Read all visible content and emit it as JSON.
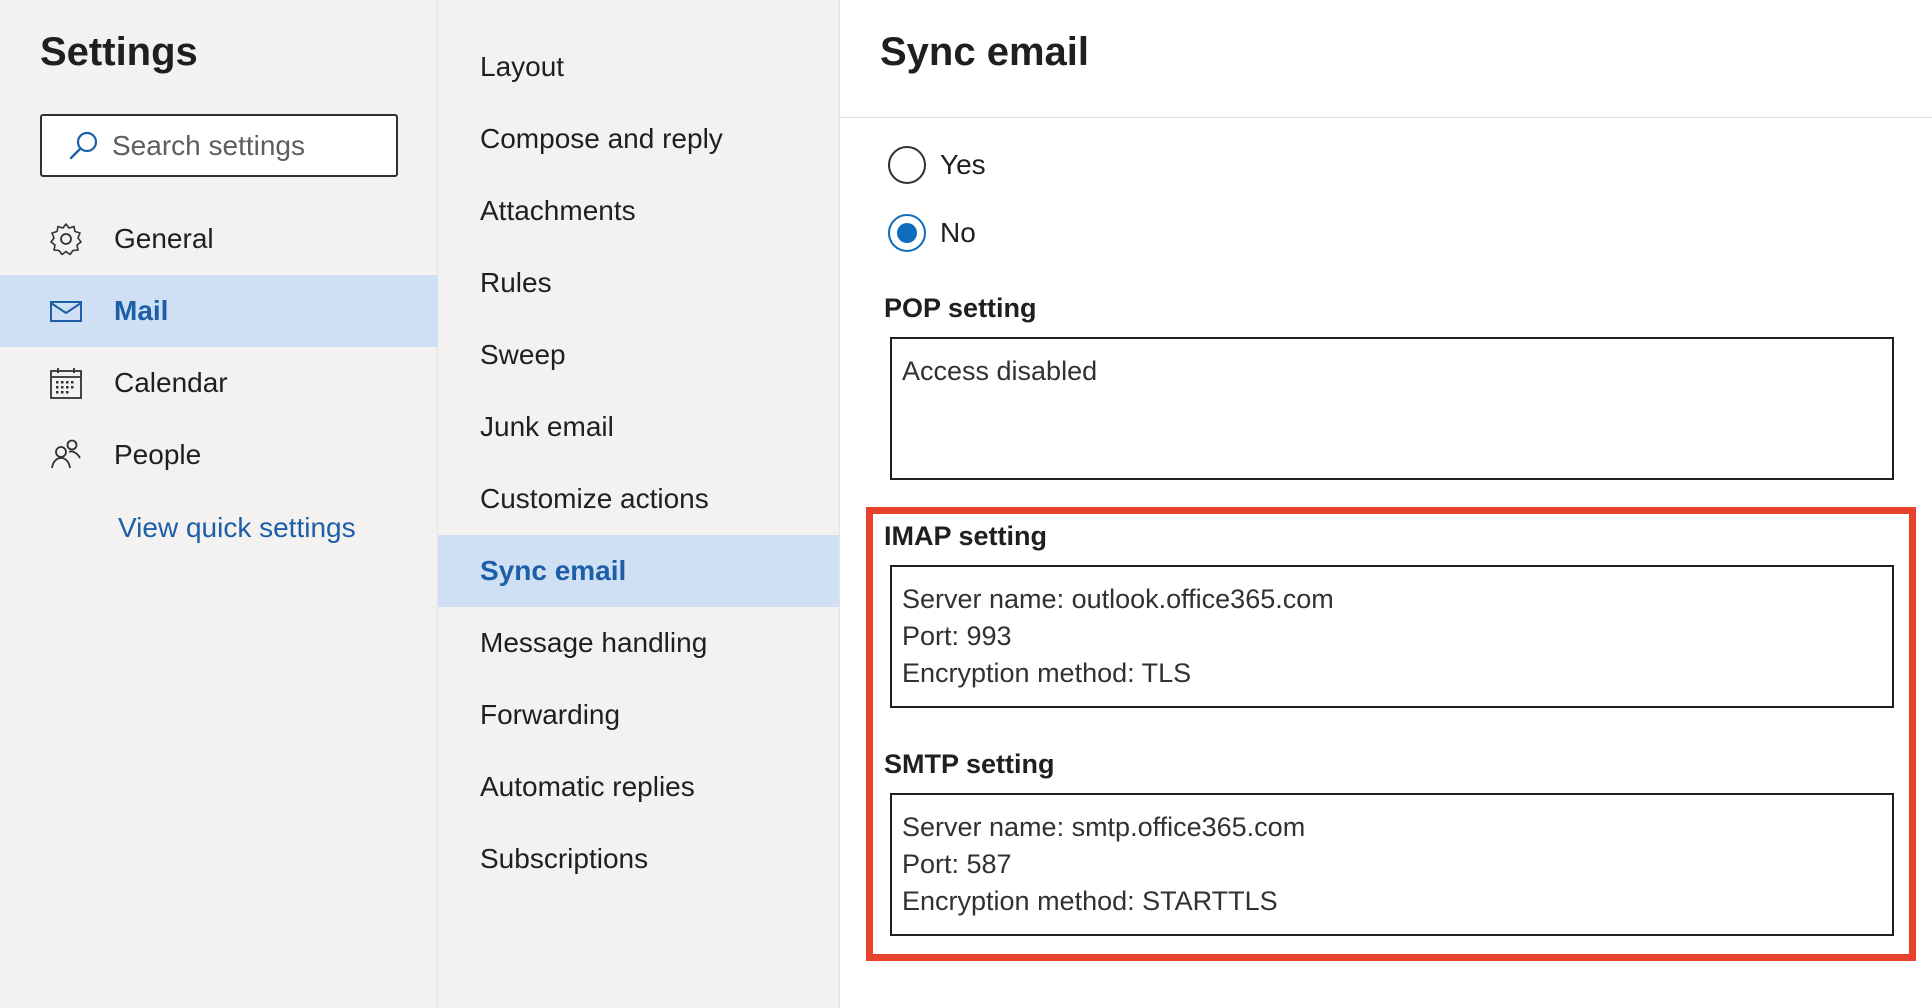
{
  "settings_title": "Settings",
  "search": {
    "placeholder": "Search settings"
  },
  "nav": {
    "items": [
      {
        "label": "General",
        "icon": "gear-icon",
        "selected": false
      },
      {
        "label": "Mail",
        "icon": "mail-icon",
        "selected": true
      },
      {
        "label": "Calendar",
        "icon": "calendar-icon",
        "selected": false
      },
      {
        "label": "People",
        "icon": "people-icon",
        "selected": false
      }
    ],
    "quick_link": "View quick settings"
  },
  "mail_sections": {
    "items": [
      "Layout",
      "Compose and reply",
      "Attachments",
      "Rules",
      "Sweep",
      "Junk email",
      "Customize actions",
      "Sync email",
      "Message handling",
      "Forwarding",
      "Automatic replies",
      "Subscriptions"
    ],
    "selected": "Sync email"
  },
  "content": {
    "title": "Sync email",
    "radio_options": [
      {
        "label": "Yes",
        "checked": false
      },
      {
        "label": "No",
        "checked": true
      }
    ],
    "pop": {
      "label": "POP setting",
      "lines": [
        "Access disabled"
      ]
    },
    "imap": {
      "label": "IMAP setting",
      "lines": [
        "Server name: outlook.office365.com",
        "Port: 993",
        "Encryption method: TLS"
      ]
    },
    "smtp": {
      "label": "SMTP setting",
      "lines": [
        "Server name: smtp.office365.com",
        "Port: 587",
        "Encryption method: STARTTLS"
      ]
    }
  },
  "colors": {
    "accent": "#1d5ea8",
    "selection": "#cfe0f4",
    "pane_background": "#f3f2f1",
    "highlight": "#e8412c",
    "radio_checked": "#0f6cbd"
  }
}
